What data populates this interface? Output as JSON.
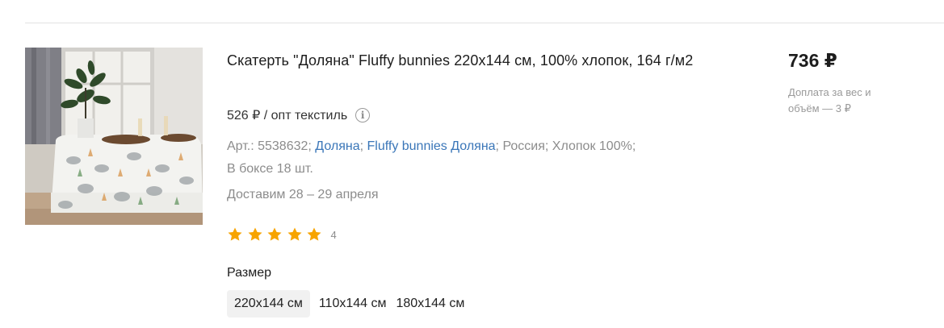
{
  "product": {
    "title": "Скатерть \"Доляна\" Fluffy bunnies 220х144 см, 100% хлопок, 164 г/м2",
    "wholesale_price": "526 ₽ / опт текстиль",
    "info_icon": "info-icon",
    "article_prefix": "Арт.: 5538632; ",
    "brand_link": "Доляна",
    "sep1": "; ",
    "collection_link": "Fluffy bunnies Доляна",
    "meta_tail": "; Россия; Хлопок 100%;",
    "box_info": "В боксе 18 шт.",
    "delivery": "Доставим 28 – 29 апреля",
    "rating": {
      "stars": 5,
      "max": 5,
      "count": "4",
      "star_color": "#f7a400"
    },
    "size_label": "Размер",
    "sizes": [
      "220х144 см",
      "110х144 см",
      "180х144 см"
    ],
    "selected_size": "220х144 см",
    "price": "736 ₽",
    "surcharge": "Доплата за вес и объём — 3 ₽"
  },
  "colors": {
    "link": "#3a76b8",
    "muted": "#8c8c8c"
  }
}
